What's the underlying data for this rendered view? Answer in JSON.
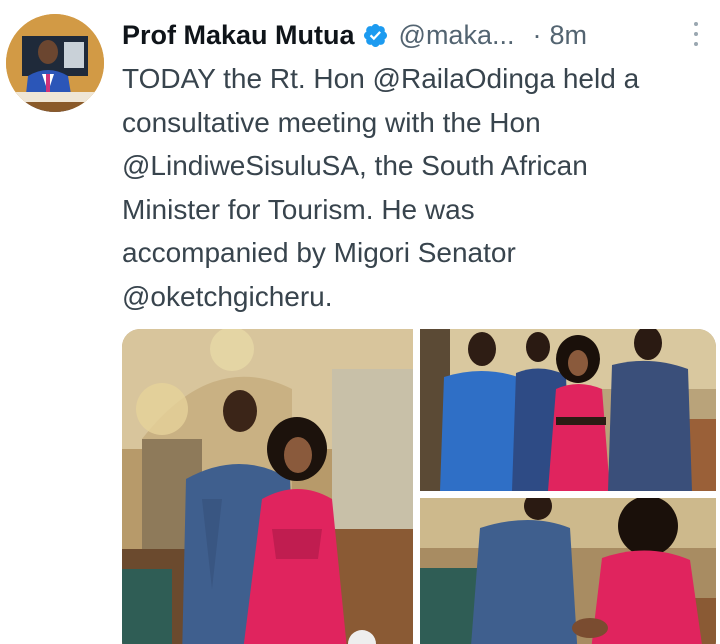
{
  "tweet": {
    "author_name": "Prof Makau Mutua",
    "handle": "@maka...",
    "separator": "·",
    "time": "8m",
    "text_lines": [
      "TODAY the Rt. Hon @RailaOdinga held a",
      "consultative meeting with the Hon",
      "@LindiweSisuluSA, the South African",
      "Minister for Tourism.  He was",
      "accompanied by Migori Senator",
      "@oketchgicheru."
    ]
  },
  "icons": {
    "verified": "verified-badge-icon",
    "more": "more-options-icon"
  },
  "colors": {
    "verified_blue": "#1d9bf0",
    "name": "#0f1419",
    "secondary": "#536471",
    "body_text": "#38444d"
  }
}
